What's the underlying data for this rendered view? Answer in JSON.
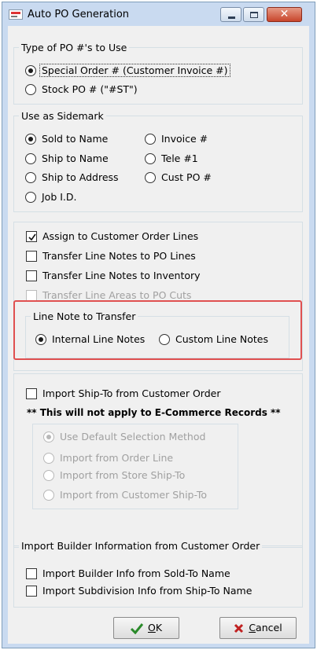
{
  "window": {
    "title": "Auto PO Generation",
    "close_glyph": "✕"
  },
  "type_group": {
    "title": "Type of PO #'s to Use",
    "options": [
      {
        "label": "Special Order #  (Customer Invoice #)",
        "selected": true
      },
      {
        "label": "Stock PO # (\"#ST\")",
        "selected": false
      }
    ]
  },
  "sidemark_group": {
    "title": "Use as Sidemark",
    "options": [
      {
        "label": "Sold to Name",
        "selected": true
      },
      {
        "label": "Ship to Name",
        "selected": false
      },
      {
        "label": "Ship to Address",
        "selected": false
      },
      {
        "label": "Job I.D.",
        "selected": false
      },
      {
        "label": "Invoice #",
        "selected": false
      },
      {
        "label": "Tele #1",
        "selected": false
      },
      {
        "label": "Cust PO #",
        "selected": false
      }
    ]
  },
  "lines_group": {
    "checkboxes": [
      {
        "label": "Assign to Customer Order Lines",
        "checked": true,
        "enabled": true
      },
      {
        "label": "Transfer Line Notes to  PO Lines",
        "checked": false,
        "enabled": true
      },
      {
        "label": "Transfer Line Notes to Inventory",
        "checked": false,
        "enabled": true
      },
      {
        "label": "Transfer Line Areas to PO Cuts",
        "checked": false,
        "enabled": false
      }
    ],
    "line_note": {
      "title": "Line Note to Transfer",
      "options": [
        {
          "label": "Internal Line Notes",
          "selected": true
        },
        {
          "label": "Custom Line Notes",
          "selected": false
        }
      ]
    }
  },
  "shipto_group": {
    "checkbox": {
      "label": "Import Ship-To from Customer Order",
      "checked": false
    },
    "warning": "** This will not apply to E-Commerce Records **",
    "options": [
      {
        "label": "Use Default Selection Method",
        "selected": true
      },
      {
        "label": "Import from Order Line",
        "selected": false
      },
      {
        "label": "Import from Store Ship-To",
        "selected": false
      },
      {
        "label": "Import from Customer Ship-To",
        "selected": false
      }
    ]
  },
  "builder_group": {
    "title": "Import Builder Information from Customer Order",
    "checkboxes": [
      {
        "label": "Import Builder Info from Sold-To Name",
        "checked": false
      },
      {
        "label": "Import Subdivision Info from Ship-To Name",
        "checked": false
      }
    ]
  },
  "buttons": {
    "ok": {
      "mnemonic": "O",
      "rest": "K"
    },
    "cancel": {
      "mnemonic": "C",
      "rest": "ancel"
    }
  },
  "colors": {
    "highlight": "#e05050",
    "ok_icon": "#2a8a2a",
    "cancel_icon": "#c02020"
  }
}
